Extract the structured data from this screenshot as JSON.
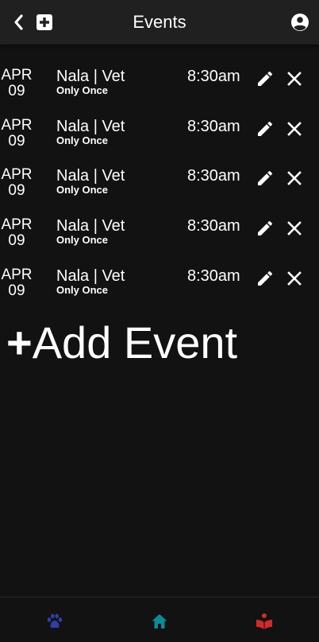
{
  "app": {
    "title": "Events"
  },
  "topbar": {
    "back_icon": "chevron-left-icon",
    "add_icon": "plus-square-icon",
    "account_icon": "account-circle-icon"
  },
  "events": [
    {
      "month": "APR",
      "day": "09",
      "name": "Nala | Vet",
      "frequency": "Only Once",
      "time": "8:30am"
    },
    {
      "month": "APR",
      "day": "09",
      "name": "Nala | Vet",
      "frequency": "Only Once",
      "time": "8:30am"
    },
    {
      "month": "APR",
      "day": "09",
      "name": "Nala | Vet",
      "frequency": "Only Once",
      "time": "8:30am"
    },
    {
      "month": "APR",
      "day": "09",
      "name": "Nala | Vet",
      "frequency": "Only Once",
      "time": "8:30am"
    },
    {
      "month": "APR",
      "day": "09",
      "name": "Nala | Vet",
      "frequency": "Only Once",
      "time": "8:30am"
    }
  ],
  "add_event": {
    "plus": "+",
    "label": "Add Event"
  },
  "bottom_nav": {
    "items": [
      {
        "icon": "paw-icon",
        "color": "#2f3ea8"
      },
      {
        "icon": "home-icon",
        "color": "#0e8a96"
      },
      {
        "icon": "book-reader-icon",
        "color": "#d02a2a"
      }
    ]
  },
  "colors": {
    "background": "#121212",
    "topbar": "#202020",
    "text": "#ffffff"
  }
}
